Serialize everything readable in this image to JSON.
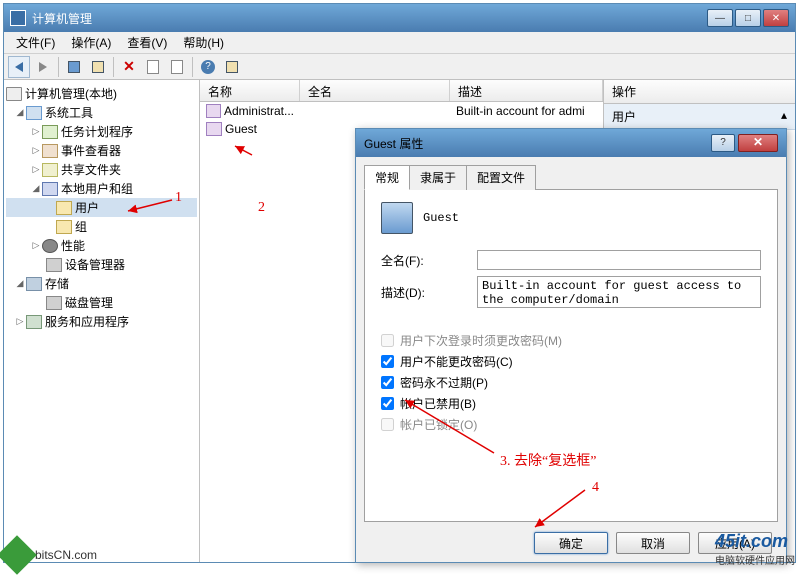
{
  "window": {
    "title": "计算机管理"
  },
  "menu": {
    "file": "文件(F)",
    "action": "操作(A)",
    "view": "查看(V)",
    "help": "帮助(H)"
  },
  "tree": {
    "root": "计算机管理(本地)",
    "sys_tools": "系统工具",
    "task_sched": "任务计划程序",
    "event_viewer": "事件查看器",
    "shared": "共享文件夹",
    "local_users": "本地用户和组",
    "users": "用户",
    "groups": "组",
    "perf": "性能",
    "devmgr": "设备管理器",
    "storage": "存储",
    "diskmgr": "磁盘管理",
    "services": "服务和应用程序"
  },
  "columns": {
    "name": "名称",
    "fullname": "全名",
    "desc": "描述"
  },
  "list": {
    "admin_name": "Administrat...",
    "admin_desc": "Built-in account for admi",
    "guest_name": "Guest"
  },
  "actions": {
    "header": "操作",
    "item": "用户",
    "arrow": "▴"
  },
  "dialog": {
    "title": "Guest 属性",
    "tabs": {
      "general": "常规",
      "member": "隶属于",
      "profile": "配置文件"
    },
    "username": "Guest",
    "fullname_label": "全名(F):",
    "desc_label": "描述(D):",
    "desc_value": "Built-in account for guest access to the computer/domain",
    "chk_mustchange": "用户下次登录时须更改密码(M)",
    "chk_cantchange": "用户不能更改密码(C)",
    "chk_noexpire": "密码永不过期(P)",
    "chk_disabled": "帐户已禁用(B)",
    "chk_locked": "帐户已锁定(O)",
    "btn_ok": "确定",
    "btn_cancel": "取消",
    "btn_apply": "应用(A)"
  },
  "annotations": {
    "n1": "1",
    "n2": "2",
    "n3": "3. 去除“复选框”",
    "n4": "4"
  },
  "watermarks": {
    "bl": "bitsCN.com",
    "br_big": "45it.com",
    "br_sm": "电脑软硬件应用网"
  }
}
